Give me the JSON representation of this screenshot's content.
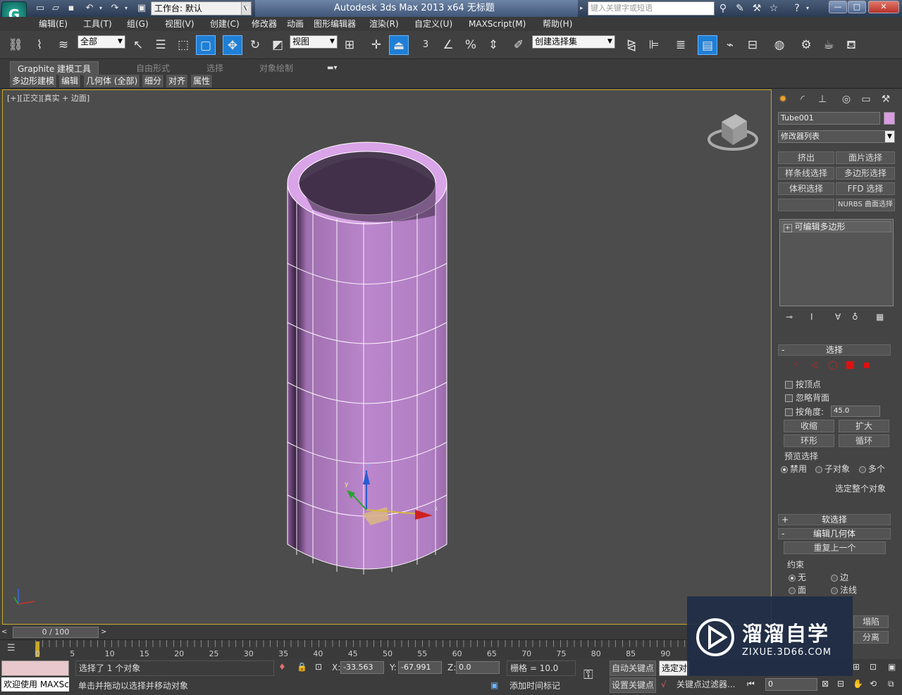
{
  "app": {
    "logo_glyph": "G",
    "window_title": "Autodesk 3ds Max  2013 x64      无标题",
    "workspace_label": "工作台: 默认",
    "search_placeholder": "键入关键字或短语",
    "win_min": "—",
    "win_max": "□",
    "win_close": "✕"
  },
  "menu": [
    "编辑(E)",
    "工具(T)",
    "组(G)",
    "视图(V)",
    "创建(C)",
    "修改器",
    "动画",
    "图形编辑器",
    "渲染(R)",
    "自定义(U)",
    "MAXScript(M)",
    "帮助(H)"
  ],
  "toolbar": {
    "filter_value": "全部",
    "refcoord_value": "视图",
    "named_set_value": "创建选择集",
    "snap_label": "3"
  },
  "ribbon": {
    "tabs": [
      "Graphite 建模工具",
      "自由形式",
      "选择",
      "对象绘制"
    ],
    "subtabs": [
      "多边形建模",
      "编辑",
      "几何体 (全部)",
      "细分",
      "对齐",
      "属性"
    ]
  },
  "viewport": {
    "label": "[+][正交][真实 + 边面]",
    "object_color": "#b47cc4"
  },
  "panel": {
    "object_name": "Tube001",
    "object_swatch": "#d89ce0",
    "modifier_list": "修改器列表",
    "mod_buttons": [
      "挤出",
      "面片选择",
      "样条线选择",
      "多边形选择",
      "体积选择",
      "FFD 选择",
      "",
      "NURBS 曲面选择"
    ],
    "stack_item": "可编辑多边形",
    "selection": {
      "title": "选择",
      "by_vertex": "按顶点",
      "ignore_back": "忽略背面",
      "by_angle": "按角度:",
      "angle_value": "45.0",
      "shrink": "收缩",
      "grow": "扩大",
      "ring": "环形",
      "loop": "循环",
      "preview_title": "预览选择",
      "disable": "禁用",
      "subobject": "子对象",
      "multi": "多个",
      "whole": "选定整个对象"
    },
    "soft_sel": "软选择",
    "edit_geo": "编辑几何体",
    "repeat_last": "重复上一个",
    "constraint_title": "约束",
    "c_none": "无",
    "c_edge": "边",
    "c_face": "面",
    "c_normal": "法线",
    "collapse": "塌陷",
    "detach": "分离"
  },
  "timeline": {
    "frame": "0 / 100",
    "ticks": [
      "0",
      "5",
      "10",
      "15",
      "20",
      "25",
      "30",
      "35",
      "40",
      "45",
      "50",
      "55",
      "60",
      "65",
      "70",
      "75",
      "80",
      "85",
      "90"
    ]
  },
  "status": {
    "selected": "选择了 1 个对象",
    "hint": "单击并拖动以选择并移动对象",
    "welcome": "欢迎使用 MAXSc",
    "x": "-33.563",
    "y": "-67.991",
    "z": "0.0",
    "grid": "栅格 = 10.0",
    "add_time_tag": "添加时间标记",
    "auto_key": "自动关键点",
    "set_key": "设置关键点",
    "selected_obj": "选定对",
    "key_filters": "关键点过滤器...",
    "frame_field": "0"
  },
  "watermark": {
    "title": "溜溜自学",
    "url": "ZIXUE.3D66.COM"
  }
}
